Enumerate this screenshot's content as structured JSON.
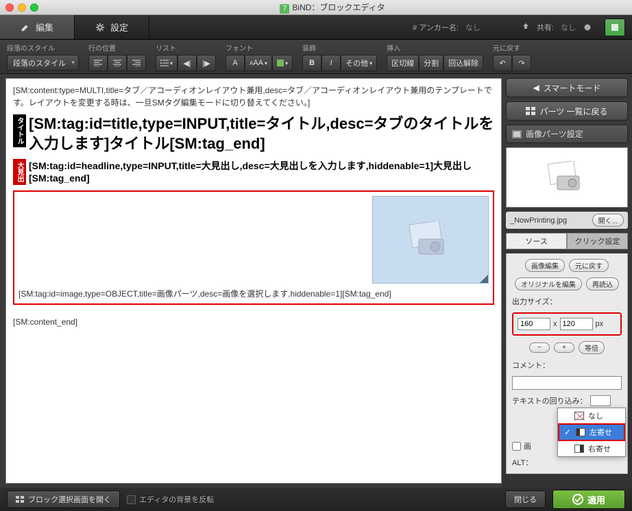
{
  "window": {
    "app_badge": "7",
    "title": "BiND：ブロックエディタ"
  },
  "maintabs": {
    "edit": "編集",
    "settings": "設定"
  },
  "anchor": {
    "label": "# アンカー名:",
    "value": "なし",
    "share_label": "共有:",
    "share_value": "なし"
  },
  "toolbar": {
    "para_style": {
      "label": "段落のスタイル",
      "dd": "段落のスタイル"
    },
    "line_pos": {
      "label": "行の位置"
    },
    "list": {
      "label": "リスト"
    },
    "font": {
      "label": "フォント",
      "a": "A",
      "aa": "AA"
    },
    "decor": {
      "label": "装飾",
      "b": "B",
      "i": "I",
      "other": "その他"
    },
    "insert": {
      "label": "挿入",
      "b1": "区切線",
      "b2": "分割",
      "b3": "回込解除"
    },
    "undo": {
      "label": "元に戻す"
    }
  },
  "content": {
    "sm_multi": "[SM:content:type=MULTI,title=タブ／アコーディオンレイアウト兼用,desc=タブ／アコーディオンレイアウト兼用のテンプレートです。レイアウトを変更する時は、一旦SMタグ編集モードに切り替えてください。]",
    "chip_title": "タイトル",
    "title_text": "[SM:tag:id=title,type=INPUT,title=タイトル,desc=タブのタイトルを入力します]タイトル[SM:tag_end]",
    "chip_headline": "大見出",
    "headline_text": "[SM:tag:id=headline,type=INPUT,title=大見出し,desc=大見出しを入力します,hiddenable=1]大見出し[SM:tag_end]",
    "image_tag": "[SM:tag:id=image,type=OBJECT,title=画像パーツ,desc=画像を選択します,hiddenable=1][SM:tag_end]",
    "content_end": "[SM:content_end]"
  },
  "sidebar": {
    "smart_mode": "スマートモード",
    "back_list": "パーツ 一覧に戻る",
    "panel_title": "画像パーツ設定",
    "filename": "_NowPrinting.jpg",
    "open": "開く...",
    "tab_source": "ソース",
    "tab_click": "クリック設定",
    "edit_image": "画像編集",
    "revert": "元に戻す",
    "edit_original": "オリジナルを編集",
    "reload": "再読込",
    "output_size": "出力サイズ：",
    "width": "160",
    "height": "120",
    "px": "px",
    "minus": "−",
    "plus": "+",
    "equal": "等倍",
    "comment": "コメント：",
    "text_wrap": "テキストの回り込み：",
    "wrap_opts": {
      "none": "なし",
      "left": "左寄せ",
      "right": "右寄せ"
    },
    "alt": "ALT："
  },
  "footer": {
    "block_select": "ブロック選択画面を開く",
    "invert_bg": "エディタの背景を反転",
    "close": "閉じる",
    "apply": "適用"
  }
}
